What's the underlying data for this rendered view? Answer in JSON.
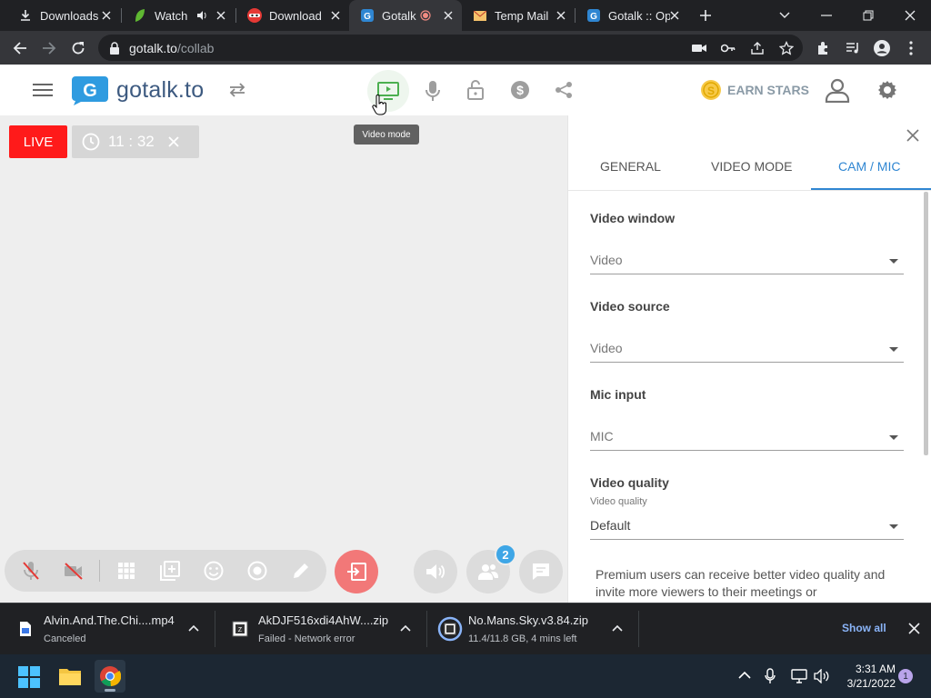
{
  "browser": {
    "tabs": [
      {
        "title": "Downloads",
        "icon": "download-icon"
      },
      {
        "title": "Watch",
        "icon": "green-leaf-icon"
      },
      {
        "title": "Download",
        "icon": "red-mask-icon"
      },
      {
        "title": "Gotalk",
        "icon": "gotalk-icon",
        "active": true
      },
      {
        "title": "Temp Mail",
        "icon": "envelope-icon"
      },
      {
        "title": "Gotalk :: Op",
        "icon": "gotalk-icon"
      }
    ],
    "url_host": "gotalk.to",
    "url_path": "/collab"
  },
  "app": {
    "brand": "gotalk.to",
    "earn_stars": "EARN STARS",
    "tooltip": "Video mode",
    "live_label": "LIVE",
    "timer": "11 : 32",
    "participants_badge": "2",
    "accent_color": "#2f86d2",
    "live_color": "#ff1a1a"
  },
  "panel": {
    "tabs": [
      "GENERAL",
      "VIDEO MODE",
      "CAM / MIC"
    ],
    "active_tab": "CAM / MIC",
    "video_window_label": "Video window",
    "video_window_value": "Video",
    "video_source_label": "Video source",
    "video_source_value": "Video",
    "mic_input_label": "Mic input",
    "mic_input_value": "MIC",
    "video_quality_label": "Video quality",
    "video_quality_sublabel": "Video quality",
    "video_quality_value": "Default",
    "premium_text": "Premium users can receive better video quality and invite more viewers to their meetings or"
  },
  "downloads": [
    {
      "name": "Alvin.And.The.Chi....mp4",
      "status": "Canceled"
    },
    {
      "name": "AkDJF516xdi4AhW....zip",
      "status": "Failed - Network error"
    },
    {
      "name": "No.Mans.Sky.v3.84.zip",
      "status": "11.4/11.8 GB, 4 mins left"
    }
  ],
  "show_all": "Show all",
  "taskbar": {
    "time": "3:31 AM",
    "date": "3/21/2022",
    "notifications": "1"
  }
}
